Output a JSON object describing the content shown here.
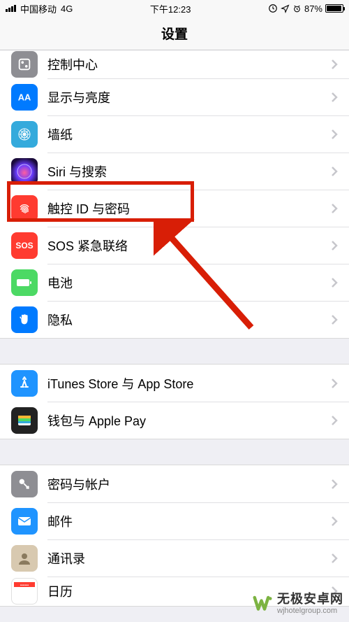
{
  "status": {
    "carrier": "中国移动",
    "network": "4G",
    "time": "下午12:23",
    "battery_pct": "87%"
  },
  "nav": {
    "title": "设置"
  },
  "group1": {
    "items": [
      {
        "label": "控制中心"
      },
      {
        "label": "显示与亮度"
      },
      {
        "label": "墙纸"
      },
      {
        "label": "Siri 与搜索"
      },
      {
        "label": "触控 ID 与密码"
      },
      {
        "label": "SOS 紧急联络"
      },
      {
        "label": "电池"
      },
      {
        "label": "隐私"
      }
    ]
  },
  "group2": {
    "items": [
      {
        "label": "iTunes Store 与 App Store"
      },
      {
        "label": "钱包与 Apple Pay"
      }
    ]
  },
  "group3": {
    "items": [
      {
        "label": "密码与帐户"
      },
      {
        "label": "邮件"
      },
      {
        "label": "通讯录"
      },
      {
        "label": "日历"
      }
    ]
  },
  "watermark": {
    "title": "无极安卓网",
    "subtitle": "wjhotelgroup.com"
  },
  "colors": {
    "highlight": "#d81e06",
    "grey_icon": "#8e8e93",
    "blue": "#007aff",
    "lightblue": "#34aadc",
    "multicolor": "#5856d6",
    "red": "#ff3b30",
    "green": "#4cd964"
  }
}
